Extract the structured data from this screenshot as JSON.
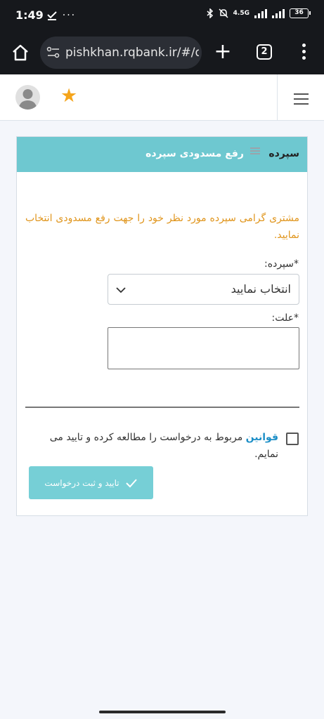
{
  "status_bar": {
    "time": "1:49",
    "left_icons": "⟀ ···",
    "network": "4.5G",
    "battery": "36"
  },
  "browser": {
    "url": "pishkhan.rqbank.ir/#/de",
    "tab_count": "2",
    "plus_glyph": "+"
  },
  "header": {
    "star_glyph": "★"
  },
  "breadcrumb": {
    "first": "سپرده",
    "second": "رفع مسدودی سپرده"
  },
  "form": {
    "notice": "مشتری گرامی سپرده مورد نظر خود را جهت رفع مسدودی انتخاب نمایید.",
    "deposit_label": "*سپرده:",
    "deposit_select_value": "انتخاب نمایید",
    "reason_label": "*علت:",
    "terms_link": "قوانین",
    "terms_text": " مربوط به درخواست را مطالعه کرده و تایید می نمایم.",
    "submit_label": "تایید و ثبت درخواست"
  },
  "colors": {
    "header_bg": "#6ec8d0",
    "notice": "#e0951c",
    "link": "#1d8fc7",
    "button": "#76cfd6",
    "star": "#f5a51c"
  }
}
